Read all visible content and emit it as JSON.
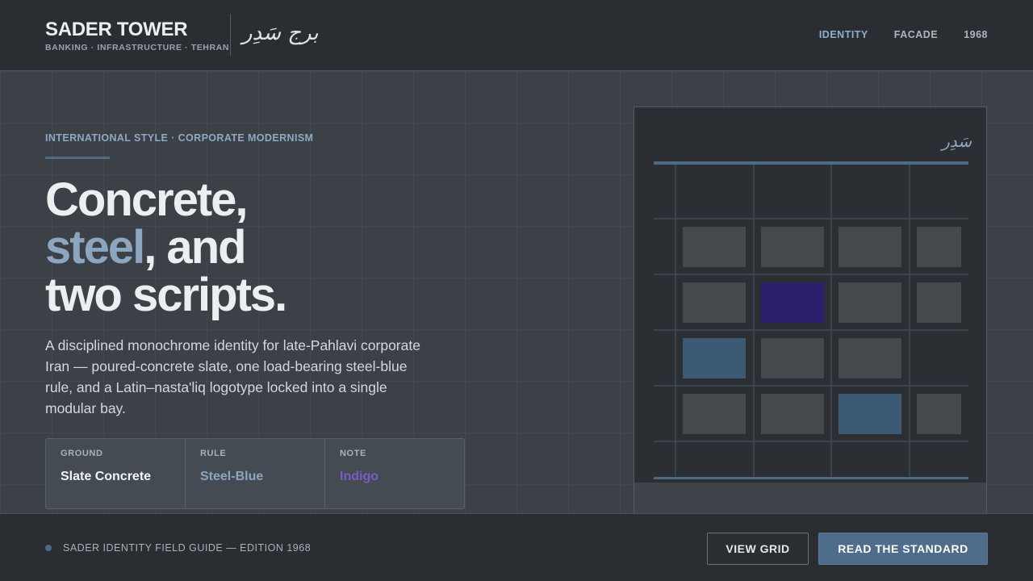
{
  "header": {
    "brand_title": "SADER TOWER",
    "brand_subtitle": "BANKING · INFRASTRUCTURE · TEHRAN",
    "brand_arabic": "برج سَدِر",
    "nav": [
      {
        "label": "IDENTITY",
        "active": true
      },
      {
        "label": "FACADE",
        "active": false
      },
      {
        "label": "1968",
        "active": false
      }
    ]
  },
  "hero": {
    "eyebrow": "INTERNATIONAL STYLE · CORPORATE MODERNISM",
    "headline": {
      "line1": "Concrete,",
      "line2_accent": "steel",
      "line2_rest": ", and",
      "line3": "two scripts."
    },
    "lead": "A disciplined monochrome identity for late-Pahlavi corporate Iran — poured-concrete slate, one load-bearing steel-blue rule, and a Latin–nasta'liq logotype locked into a single modular bay.",
    "swatches": [
      {
        "label": "GROUND",
        "value": "Slate Concrete",
        "color": "#f2f3f5"
      },
      {
        "label": "RULE",
        "value": "Steel-Blue",
        "color": "#8da6bf"
      },
      {
        "label": "NOTE",
        "value": "Indigo",
        "color": "#7a5cc4"
      }
    ]
  },
  "facade": {
    "arabic_mark": "سَدِر",
    "window_rows": [
      [
        "concrete",
        "concrete",
        "concrete",
        "concrete"
      ],
      [
        "concrete",
        "indigo",
        "concrete",
        "concrete"
      ],
      [
        "steel",
        "concrete",
        "concrete",
        "empty"
      ],
      [
        "concrete",
        "concrete",
        "steel",
        "concrete"
      ]
    ],
    "colors": {
      "concrete": "#45484c",
      "indigo": "#2b1f6e",
      "steel": "#3d5a75",
      "rule": "#4e6a85",
      "grid": "#3e4a55"
    }
  },
  "footer": {
    "caption": "SADER IDENTITY FIELD GUIDE — EDITION 1968",
    "view_grid_label": "VIEW GRID",
    "read_standard_label": "READ THE STANDARD"
  }
}
